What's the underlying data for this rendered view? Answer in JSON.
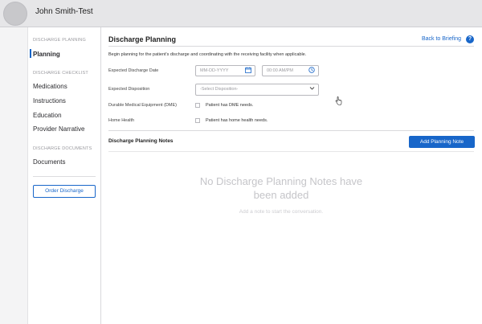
{
  "header": {
    "patient_name": "John Smith-Test"
  },
  "sidebar": {
    "sections": [
      {
        "heading": "DISCHARGE PLANNING",
        "items": [
          {
            "label": "Planning",
            "active": true
          }
        ]
      },
      {
        "heading": "DISCHARGE CHECKLIST",
        "items": [
          {
            "label": "Medications"
          },
          {
            "label": "Instructions"
          },
          {
            "label": "Education"
          },
          {
            "label": "Provider Narrative"
          }
        ]
      },
      {
        "heading": "DISCHARGE DOCUMENTS",
        "items": [
          {
            "label": "Documents"
          }
        ]
      }
    ],
    "order_button": "Order Discharge"
  },
  "main": {
    "title": "Discharge Planning",
    "back_link": "Back to Briefing",
    "help_icon": "?",
    "intro": "Begin planning for the patient's discharge and coordinating with the receiving facility when applicable.",
    "fields": {
      "expected_date": {
        "label": "Expected Discharge Date",
        "date_placeholder": "MM-DD-YYYY",
        "time_placeholder": "00:00 AM/PM"
      },
      "disposition": {
        "label": "Expected Disposition",
        "placeholder": "-Select Disposition-"
      },
      "dme": {
        "label": "Durable Medical Equipment (DME)",
        "checkbox_label": "Patient has DME needs."
      },
      "home_health": {
        "label": "Home Health",
        "checkbox_label": "Patient has home health needs."
      }
    },
    "notes": {
      "title": "Discharge Planning Notes",
      "add_button": "Add Planning Note",
      "empty_title": "No Discharge Planning Notes have been added",
      "empty_subtitle": "Add a note to start the conversation."
    }
  },
  "icons": {
    "calendar": "calendar-icon",
    "clock": "clock-icon",
    "chevron": "chevron-down-icon",
    "cursor": "hand-cursor-icon"
  },
  "colors": {
    "accent": "#1866c9"
  }
}
